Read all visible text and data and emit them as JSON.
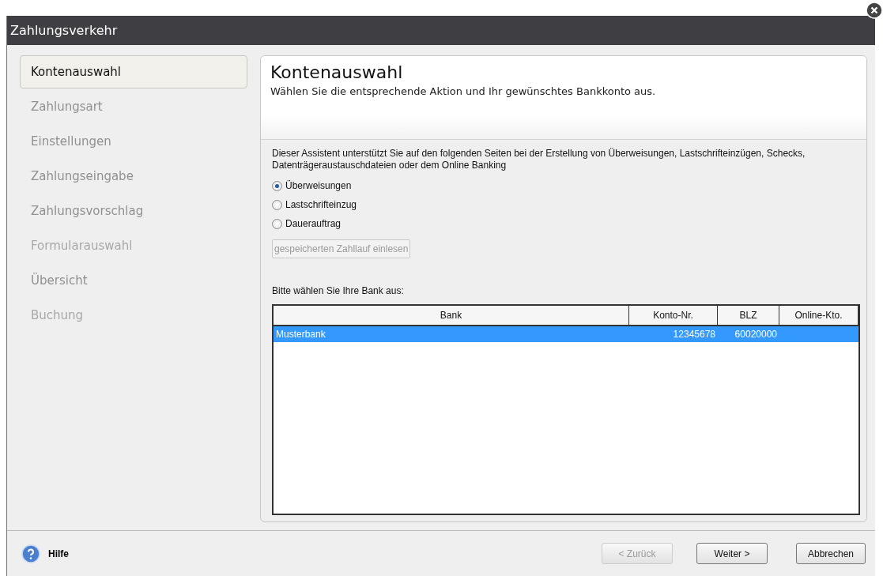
{
  "window": {
    "title": "Zahlungsverkehr"
  },
  "steps": [
    {
      "label": "Kontenauswahl",
      "selected": true,
      "disabled": false
    },
    {
      "label": "Zahlungsart",
      "selected": false,
      "disabled": false
    },
    {
      "label": "Einstellungen",
      "selected": false,
      "disabled": false
    },
    {
      "label": "Zahlungseingabe",
      "selected": false,
      "disabled": false
    },
    {
      "label": "Zahlungsvorschlag",
      "selected": false,
      "disabled": false
    },
    {
      "label": "Formularauswahl",
      "selected": false,
      "disabled": true
    },
    {
      "label": "Übersicht",
      "selected": false,
      "disabled": false
    },
    {
      "label": "Buchung",
      "selected": false,
      "disabled": true
    }
  ],
  "header": {
    "title": "Kontenauswahl",
    "subtitle": "Wählen Sie die entsprechende Aktion und Ihr gewünschtes Bankkonto aus."
  },
  "intro": "Dieser Assistent unterstützt Sie auf den folgenden Seiten bei der Erstellung von Überweisungen, Lastschrifteinzügen, Schecks, Datenträgeraustauschdateien oder dem Online Banking",
  "options": [
    {
      "label": "Überweisungen",
      "selected": true
    },
    {
      "label": "Lastschrifteinzug",
      "selected": false
    },
    {
      "label": "Dauerauftrag",
      "selected": false
    }
  ],
  "load_button": {
    "label": "gespeicherten Zahllauf einlesen",
    "disabled": true
  },
  "bank_prompt": "Bitte wählen Sie Ihre Bank aus:",
  "table": {
    "columns": [
      "Bank",
      "Konto-Nr.",
      "BLZ",
      "Online-Kto."
    ],
    "rows": [
      {
        "cells": [
          "Musterbank",
          "12345678",
          "60020000",
          ""
        ],
        "selected": true
      }
    ]
  },
  "footer": {
    "help": "Hilfe",
    "buttons": [
      {
        "label": "< Zurück",
        "disabled": true
      },
      {
        "label": "Weiter >",
        "disabled": false
      },
      {
        "label": "Abbrechen",
        "disabled": false
      }
    ]
  }
}
